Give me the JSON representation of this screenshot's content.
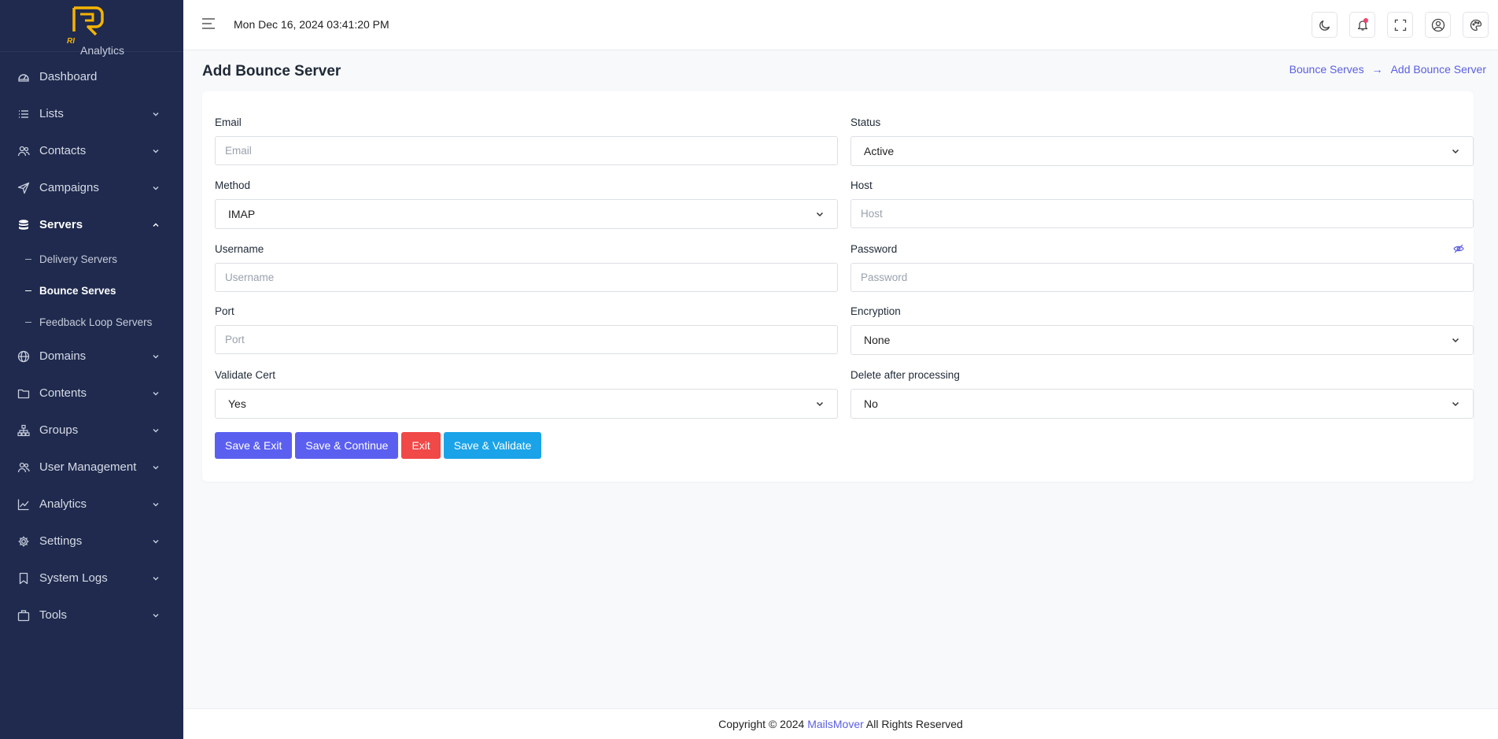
{
  "brand": {
    "logo_letters": "RI",
    "name": "Analytics"
  },
  "sidebar": {
    "items": [
      {
        "label": "Dashboard",
        "icon": "dashboard-icon"
      },
      {
        "label": "Lists",
        "icon": "list-icon"
      },
      {
        "label": "Contacts",
        "icon": "contacts-icon"
      },
      {
        "label": "Campaigns",
        "icon": "send-icon"
      },
      {
        "label": "Servers",
        "icon": "database-icon"
      },
      {
        "label": "Domains",
        "icon": "globe-icon"
      },
      {
        "label": "Contents",
        "icon": "folder-icon"
      },
      {
        "label": "Groups",
        "icon": "sitemap-icon"
      },
      {
        "label": "User Management",
        "icon": "users-icon"
      },
      {
        "label": "Analytics",
        "icon": "chart-icon"
      },
      {
        "label": "Settings",
        "icon": "gear-icon"
      },
      {
        "label": "System Logs",
        "icon": "bookmark-icon"
      },
      {
        "label": "Tools",
        "icon": "briefcase-icon"
      }
    ],
    "servers_sub": [
      {
        "label": "Delivery Servers"
      },
      {
        "label": "Bounce Serves"
      },
      {
        "label": "Feedback Loop Servers"
      }
    ]
  },
  "topbar": {
    "datetime": "Mon Dec 16, 2024 03:41:20 PM",
    "icons": [
      "moon-icon",
      "bell-icon",
      "fullscreen-icon",
      "user-icon",
      "palette-icon"
    ]
  },
  "page": {
    "title": "Add Bounce Server",
    "breadcrumb": {
      "parent": "Bounce Serves",
      "separator": "→",
      "current": "Add Bounce Server"
    }
  },
  "form": {
    "email": {
      "label": "Email",
      "placeholder": "Email",
      "value": ""
    },
    "status": {
      "label": "Status",
      "value": "Active"
    },
    "method": {
      "label": "Method",
      "value": "IMAP"
    },
    "host": {
      "label": "Host",
      "placeholder": "Host",
      "value": ""
    },
    "username": {
      "label": "Username",
      "placeholder": "Username",
      "value": ""
    },
    "password": {
      "label": "Password",
      "placeholder": "Password",
      "value": ""
    },
    "port": {
      "label": "Port",
      "placeholder": "Port",
      "value": ""
    },
    "encryption": {
      "label": "Encryption",
      "value": "None"
    },
    "validate_cert": {
      "label": "Validate Cert",
      "value": "Yes"
    },
    "delete_after": {
      "label": "Delete after processing",
      "value": "No"
    }
  },
  "buttons": {
    "save_exit": "Save & Exit",
    "save_continue": "Save & Continue",
    "exit": "Exit",
    "save_validate": "Save & Validate"
  },
  "footer": {
    "prefix": "Copyright © 2024",
    "brand": "MailsMover",
    "suffix": "All Rights Reserved"
  },
  "colors": {
    "sidebar_bg": "#1f2a4e",
    "primary": "#5b5ff0",
    "danger": "#f14848",
    "info": "#1aa3e8",
    "brand_gold": "#f5b301"
  }
}
